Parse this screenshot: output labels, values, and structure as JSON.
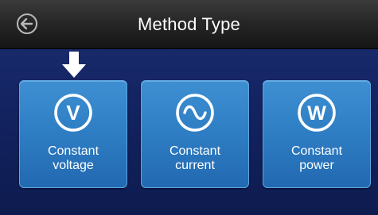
{
  "header": {
    "title": "Method Type",
    "back_icon": "back-arrow-circle-icon"
  },
  "pointer": {
    "icon": "down-arrow-icon"
  },
  "methods": [
    {
      "line1": "Constant",
      "line2": "voltage",
      "icon_letter": "V",
      "icon": "voltage-circle-icon"
    },
    {
      "line1": "Constant",
      "line2": "current",
      "icon_letter": "",
      "icon": "sine-wave-circle-icon"
    },
    {
      "line1": "Constant",
      "line2": "power",
      "icon_letter": "W",
      "icon": "watt-circle-icon"
    }
  ],
  "colors": {
    "background": "#142463",
    "header": "#272727",
    "button": "#2f7fc5",
    "text": "#ffffff"
  }
}
